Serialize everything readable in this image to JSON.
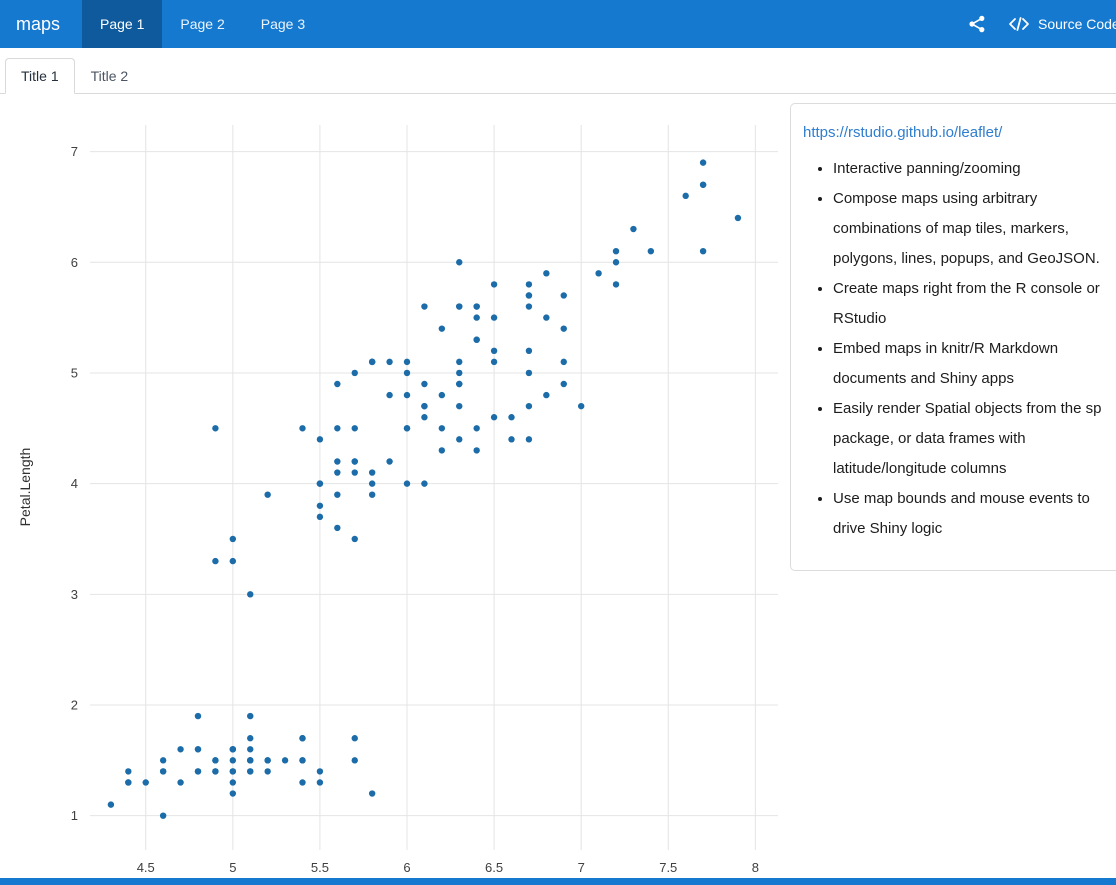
{
  "navbar": {
    "brand": "maps",
    "tabs": [
      {
        "label": "Page 1",
        "active": true
      },
      {
        "label": "Page 2",
        "active": false
      },
      {
        "label": "Page 3",
        "active": false
      }
    ],
    "source_code_label": "Source Code",
    "icons": [
      "share-icon",
      "code-icon"
    ]
  },
  "tabset": {
    "tabs": [
      {
        "label": "Title 1",
        "active": true
      },
      {
        "label": "Title 2",
        "active": false
      }
    ]
  },
  "sidebar": {
    "link": "https://rstudio.github.io/leaflet/",
    "bullets": [
      "Interactive panning/zooming",
      "Compose maps using arbitrary combinations of map tiles, markers, polygons, lines, popups, and GeoJSON.",
      "Create maps right from the R console or RStudio",
      "Embed maps in knitr/R Markdown documents and Shiny apps",
      "Easily render Spatial objects from the sp package, or data frames with latitude/longitude columns",
      "Use map bounds and mouse events to drive Shiny logic"
    ]
  },
  "colors": {
    "navbar_bg": "#1579d0",
    "navbar_active_bg": "#0f5a9d",
    "link": "#2e7ecf",
    "point": "#1b6ca8",
    "grid": "#e4e4e4"
  },
  "chart_data": {
    "type": "scatter",
    "title": "",
    "xlabel": "",
    "ylabel": "Petal.Length",
    "x_ticks": [
      4.5,
      5,
      5.5,
      6,
      6.5,
      7,
      7.5,
      8
    ],
    "y_ticks": [
      1,
      2,
      3,
      4,
      5,
      6,
      7
    ],
    "xlim": [
      4.18,
      8.13
    ],
    "ylim": [
      0.69,
      7.24
    ],
    "grid": true,
    "legend": false,
    "x": [
      5.1,
      4.9,
      4.7,
      4.6,
      5.0,
      5.4,
      4.6,
      5.0,
      4.4,
      4.9,
      5.4,
      4.8,
      4.8,
      4.3,
      5.8,
      5.7,
      5.4,
      5.1,
      5.7,
      5.1,
      5.4,
      5.1,
      4.6,
      5.1,
      4.8,
      5.0,
      5.0,
      5.2,
      5.2,
      4.7,
      4.8,
      5.4,
      5.2,
      5.5,
      4.9,
      5.0,
      5.5,
      4.9,
      4.4,
      5.1,
      5.0,
      4.5,
      4.4,
      5.0,
      5.1,
      4.8,
      5.1,
      4.6,
      5.3,
      5.0,
      7.0,
      6.4,
      6.9,
      5.5,
      6.5,
      5.7,
      6.3,
      4.9,
      6.6,
      5.2,
      5.0,
      5.9,
      6.0,
      6.1,
      5.6,
      6.7,
      5.6,
      5.8,
      6.2,
      5.6,
      5.9,
      6.1,
      6.3,
      6.1,
      6.4,
      6.6,
      6.8,
      6.7,
      6.0,
      5.7,
      5.5,
      5.5,
      5.8,
      6.0,
      5.4,
      6.0,
      6.7,
      6.3,
      5.6,
      5.5,
      5.5,
      6.1,
      5.8,
      5.0,
      5.6,
      5.7,
      5.7,
      6.2,
      5.1,
      5.7,
      6.3,
      5.8,
      7.1,
      6.3,
      6.5,
      7.6,
      4.9,
      7.3,
      6.7,
      7.2,
      6.5,
      6.4,
      6.8,
      5.7,
      5.8,
      6.4,
      6.5,
      7.7,
      7.7,
      6.0,
      6.9,
      5.6,
      7.7,
      6.3,
      6.7,
      7.2,
      6.2,
      6.1,
      6.4,
      7.2,
      7.4,
      7.9,
      6.4,
      6.3,
      6.1,
      7.7,
      6.3,
      6.4,
      6.0,
      6.9,
      6.7,
      6.9,
      5.8,
      6.8,
      6.7,
      6.7,
      6.3,
      6.5,
      6.2,
      5.9
    ],
    "y": [
      1.4,
      1.4,
      1.3,
      1.5,
      1.4,
      1.7,
      1.4,
      1.5,
      1.4,
      1.5,
      1.5,
      1.6,
      1.4,
      1.1,
      1.2,
      1.5,
      1.3,
      1.4,
      1.7,
      1.5,
      1.7,
      1.5,
      1.0,
      1.7,
      1.9,
      1.6,
      1.6,
      1.5,
      1.4,
      1.6,
      1.6,
      1.5,
      1.5,
      1.4,
      1.5,
      1.2,
      1.3,
      1.4,
      1.3,
      1.5,
      1.3,
      1.3,
      1.3,
      1.6,
      1.9,
      1.4,
      1.6,
      1.4,
      1.5,
      1.4,
      4.7,
      4.5,
      4.9,
      4.0,
      4.6,
      4.5,
      4.7,
      3.3,
      4.6,
      3.9,
      3.5,
      4.2,
      4.0,
      4.7,
      3.6,
      4.4,
      4.5,
      4.1,
      4.5,
      3.9,
      4.8,
      4.0,
      4.9,
      4.7,
      4.3,
      4.4,
      4.8,
      5.0,
      4.5,
      3.5,
      3.8,
      3.7,
      3.9,
      5.1,
      4.5,
      4.5,
      4.7,
      4.4,
      4.1,
      4.0,
      4.4,
      4.6,
      4.0,
      3.3,
      4.2,
      4.2,
      4.2,
      4.3,
      3.0,
      4.1,
      6.0,
      5.1,
      5.9,
      5.6,
      5.8,
      6.6,
      4.5,
      6.3,
      5.8,
      6.1,
      5.1,
      5.3,
      5.5,
      5.0,
      5.1,
      5.3,
      5.5,
      6.7,
      6.9,
      5.0,
      5.7,
      4.9,
      6.7,
      4.9,
      5.7,
      6.0,
      4.8,
      4.9,
      5.6,
      5.8,
      6.1,
      6.4,
      5.6,
      5.1,
      5.6,
      6.1,
      5.6,
      5.5,
      4.8,
      5.4,
      5.6,
      5.1,
      5.1,
      5.9,
      5.7,
      5.2,
      5.0,
      5.2,
      5.4,
      5.1
    ]
  }
}
